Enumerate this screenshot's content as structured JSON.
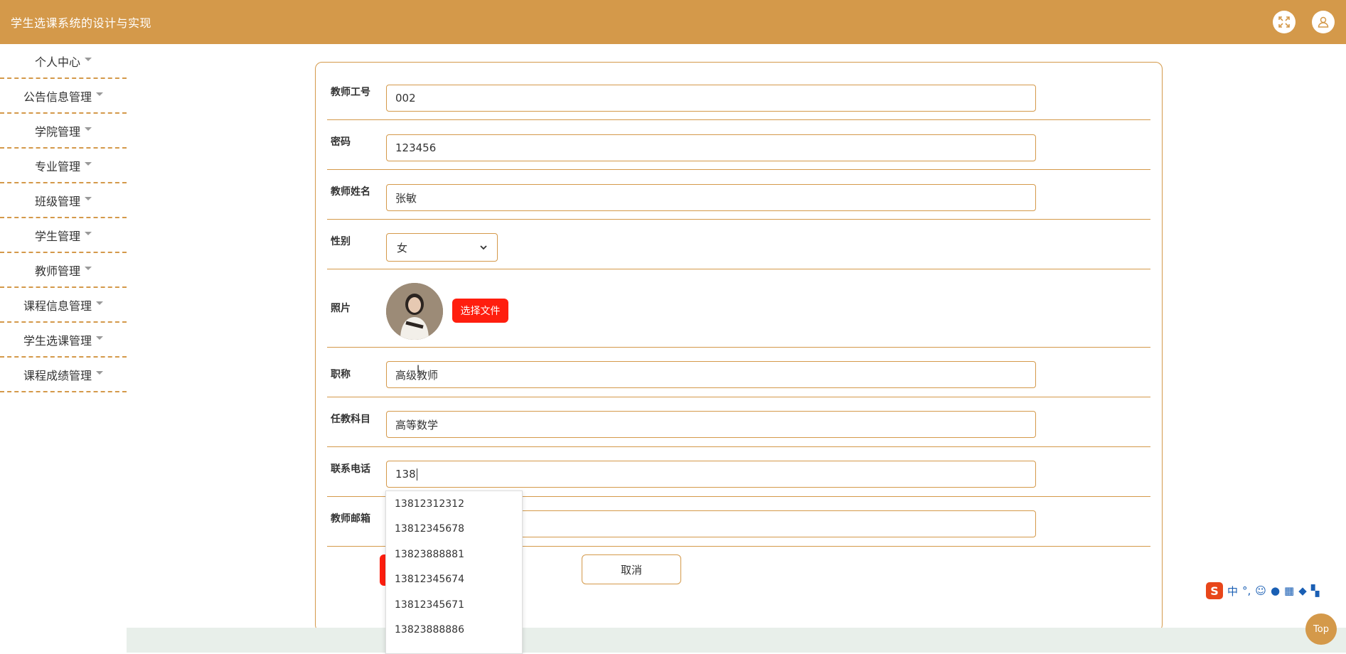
{
  "header": {
    "app_title": "学生选课系统的设计与实现"
  },
  "sidebar": {
    "items": [
      {
        "label": "个人中心"
      },
      {
        "label": "公告信息管理"
      },
      {
        "label": "学院管理"
      },
      {
        "label": "专业管理"
      },
      {
        "label": "班级管理"
      },
      {
        "label": "学生管理"
      },
      {
        "label": "教师管理"
      },
      {
        "label": "课程信息管理"
      },
      {
        "label": "学生选课管理"
      },
      {
        "label": "课程成绩管理"
      }
    ]
  },
  "form": {
    "teacher_id": {
      "label": "教师工号",
      "value": "002"
    },
    "password": {
      "label": "密码",
      "value": "123456"
    },
    "teacher_name": {
      "label": "教师姓名",
      "value": "张敏"
    },
    "gender": {
      "label": "性别",
      "value": "女"
    },
    "photo": {
      "label": "照片",
      "button": "选择文件"
    },
    "title": {
      "label": "职称",
      "value": "高级教师"
    },
    "subject": {
      "label": "任教科目",
      "value": "高等数学"
    },
    "phone": {
      "label": "联系电话",
      "value": "138"
    },
    "email": {
      "label": "教师邮箱",
      "value": ""
    },
    "cancel_label": "取消"
  },
  "autocomplete": {
    "options": [
      "13812312312",
      "13812345678",
      "13823888881",
      "13812345674",
      "13812345671",
      "13823888886"
    ]
  },
  "ime": {
    "lang": "中"
  },
  "top_button": {
    "label": "Top"
  },
  "colors": {
    "accent": "#d4994a",
    "danger": "#ff1e0e",
    "footer": "#e8efea"
  }
}
